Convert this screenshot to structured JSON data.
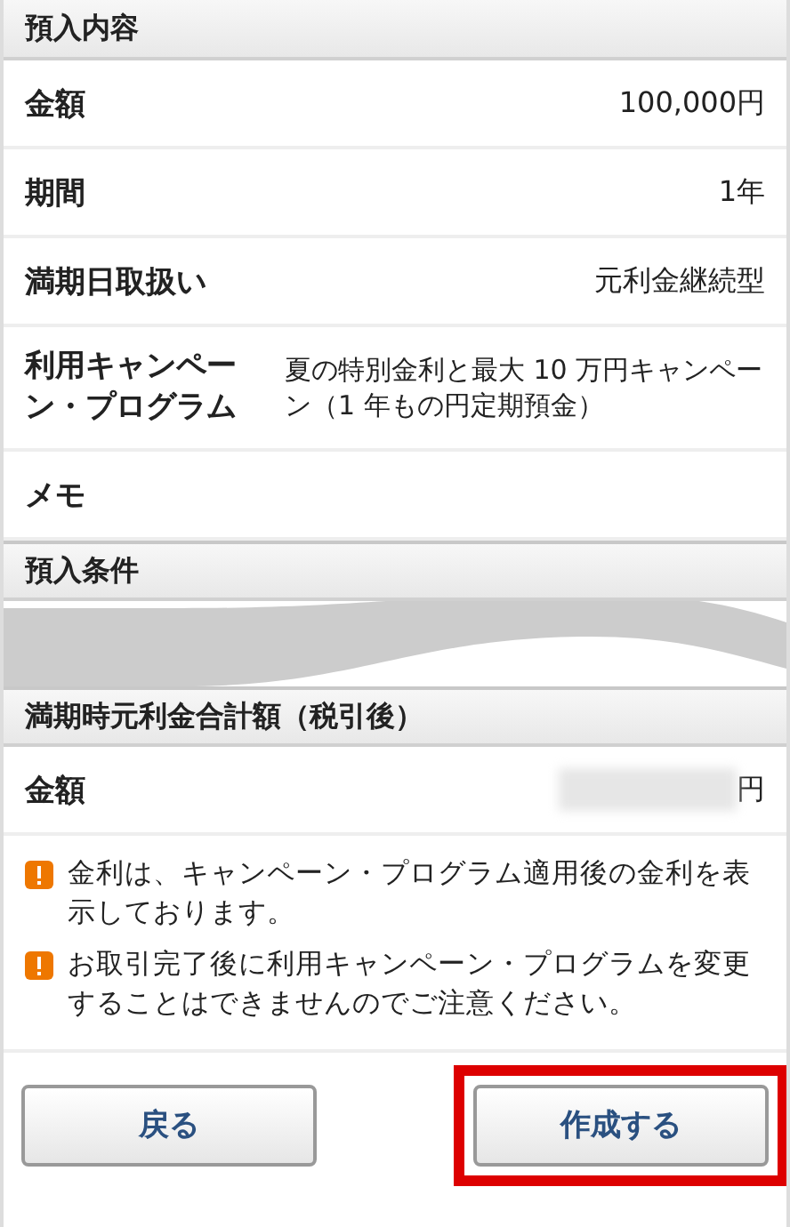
{
  "sections": [
    {
      "title": "預入内容",
      "rows": [
        {
          "label": "金額",
          "value": "100,000円"
        },
        {
          "label": "期間",
          "value": "1年"
        },
        {
          "label": "満期日取扱い",
          "value": "元利金継続型"
        },
        {
          "label": "利用キャンペーン・プログラム",
          "value": "夏の特別金利と最大 10 万円キャンペーン（1 年もの円定期預金）",
          "kind": "wide"
        },
        {
          "label": "メモ"
        }
      ],
      "collapsed": false
    },
    {
      "title": "預入条件",
      "collapsed": true
    },
    {
      "title": "満期時元利金合計額（税引後）",
      "rows": [
        {
          "label": "金額",
          "value": "円",
          "blurred": true
        }
      ],
      "collapsed": false
    }
  ],
  "notes": [
    {
      "text": "金利は、キャンペーン・プログラム適用後の金利を表示しております。"
    },
    {
      "text": "お取引完了後に利用キャンペーン・プログラムを変更することはできませんのでご注意ください。"
    }
  ],
  "buttons": [
    {
      "label": "戻る",
      "highlighted": false
    },
    {
      "label": "作成する",
      "highlighted": true
    }
  ]
}
